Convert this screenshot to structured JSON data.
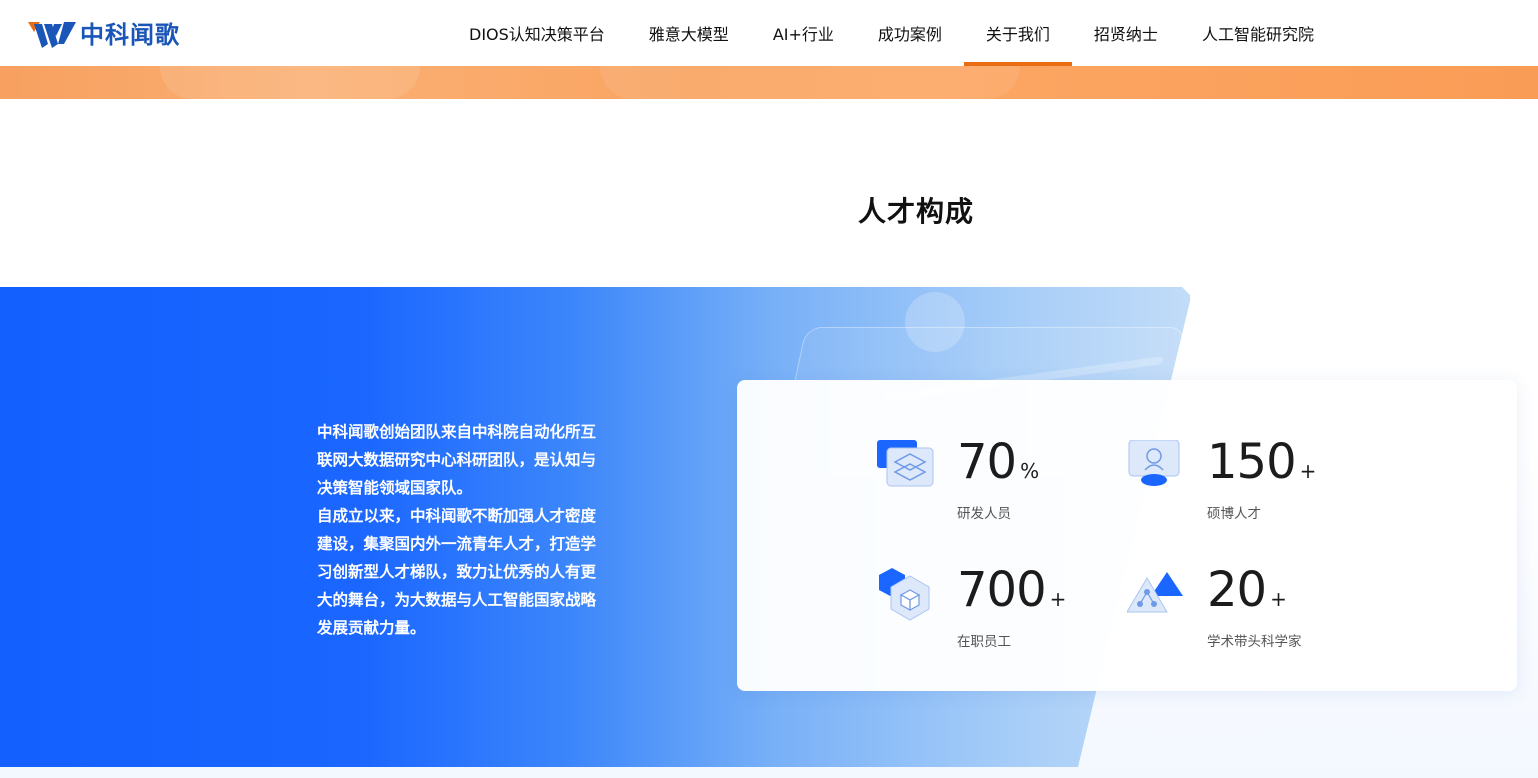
{
  "header": {
    "logo_text": "中科闻歌",
    "nav": [
      {
        "label": "DIOS认知决策平台",
        "active": false
      },
      {
        "label": "雅意大模型",
        "active": false
      },
      {
        "label": "AI+行业",
        "active": false
      },
      {
        "label": "成功案例",
        "active": false
      },
      {
        "label": "关于我们",
        "active": true
      },
      {
        "label": "招贤纳士",
        "active": false
      },
      {
        "label": "人工智能研究院",
        "active": false
      }
    ]
  },
  "section": {
    "title": "人才构成",
    "description": [
      "中科闻歌创始团队来自中科院自动化所互联网大数据研究中心科研团队，是认知与决策智能领域国家队。",
      "自成立以来，中科闻歌不断加强人才密度建设，集聚国内外一流青年人才，打造学习创新型人才梯队，致力让优秀的人有更大的舞台，为大数据与人工智能国家战略发展贡献力量。"
    ],
    "stats": [
      {
        "value": "70",
        "unit": "%",
        "label": "研发人员",
        "icon": "layers-icon"
      },
      {
        "value": "150",
        "unit": "+",
        "label": "硕博人才",
        "icon": "graduate-icon"
      },
      {
        "value": "700",
        "unit": "+",
        "label": "在职员工",
        "icon": "cube-icon"
      },
      {
        "value": "20",
        "unit": "+",
        "label": "学术带头科学家",
        "icon": "triangle-network-icon"
      }
    ]
  },
  "colors": {
    "accent": "#e96d12",
    "brand": "#1a56b8",
    "panel_blue": "#1360ff"
  }
}
